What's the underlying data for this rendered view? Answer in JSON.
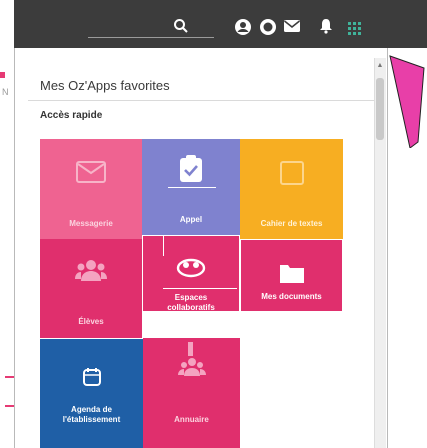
{
  "topbar": {
    "icons": [
      "search-icon",
      "account-circle-icon",
      "account-outline-icon",
      "mail-icon",
      "bell-icon",
      "apps-grid-icon"
    ]
  },
  "panel": {
    "title": "Mes Oz'Apps favorites",
    "section_title": "Accès rapide"
  },
  "left_sidebar": {
    "letter": "N"
  },
  "tiles": [
    {
      "id": "messagerie",
      "label": "Messagerie",
      "icon": "mail-icon",
      "color": "#ef6391"
    },
    {
      "id": "appel",
      "label": "Appel",
      "icon": "clipboard-check-icon",
      "color": "#7f82cf"
    },
    {
      "id": "cahier",
      "label": "Cahier de textes",
      "icon": "book-icon",
      "color": "#f7ae22"
    },
    {
      "id": "eleves",
      "label": "Élèves",
      "icon": "group-icon",
      "color": "#e02f6d"
    },
    {
      "id": "espaces",
      "label_line1": "Espaces",
      "label_line2": "collaboratifs",
      "icon": "collaboration-icon",
      "color": "#e02f6d"
    },
    {
      "id": "mesdocs",
      "label": "Mes documents",
      "icon": "folder-icon",
      "color": "#e02f6d"
    },
    {
      "id": "agenda",
      "label_line1": "Agenda de",
      "label_line2": "l'établissement",
      "icon": "calendar-icon",
      "color": "#1f5fa6"
    },
    {
      "id": "annuaire",
      "label": "Annuaire",
      "icon": "contacts-icon",
      "color": "#e02f6d"
    }
  ],
  "colors": {
    "topbar": "#3c3c3c",
    "pink": "#e02f6d",
    "pointer": "#e83fa8"
  }
}
